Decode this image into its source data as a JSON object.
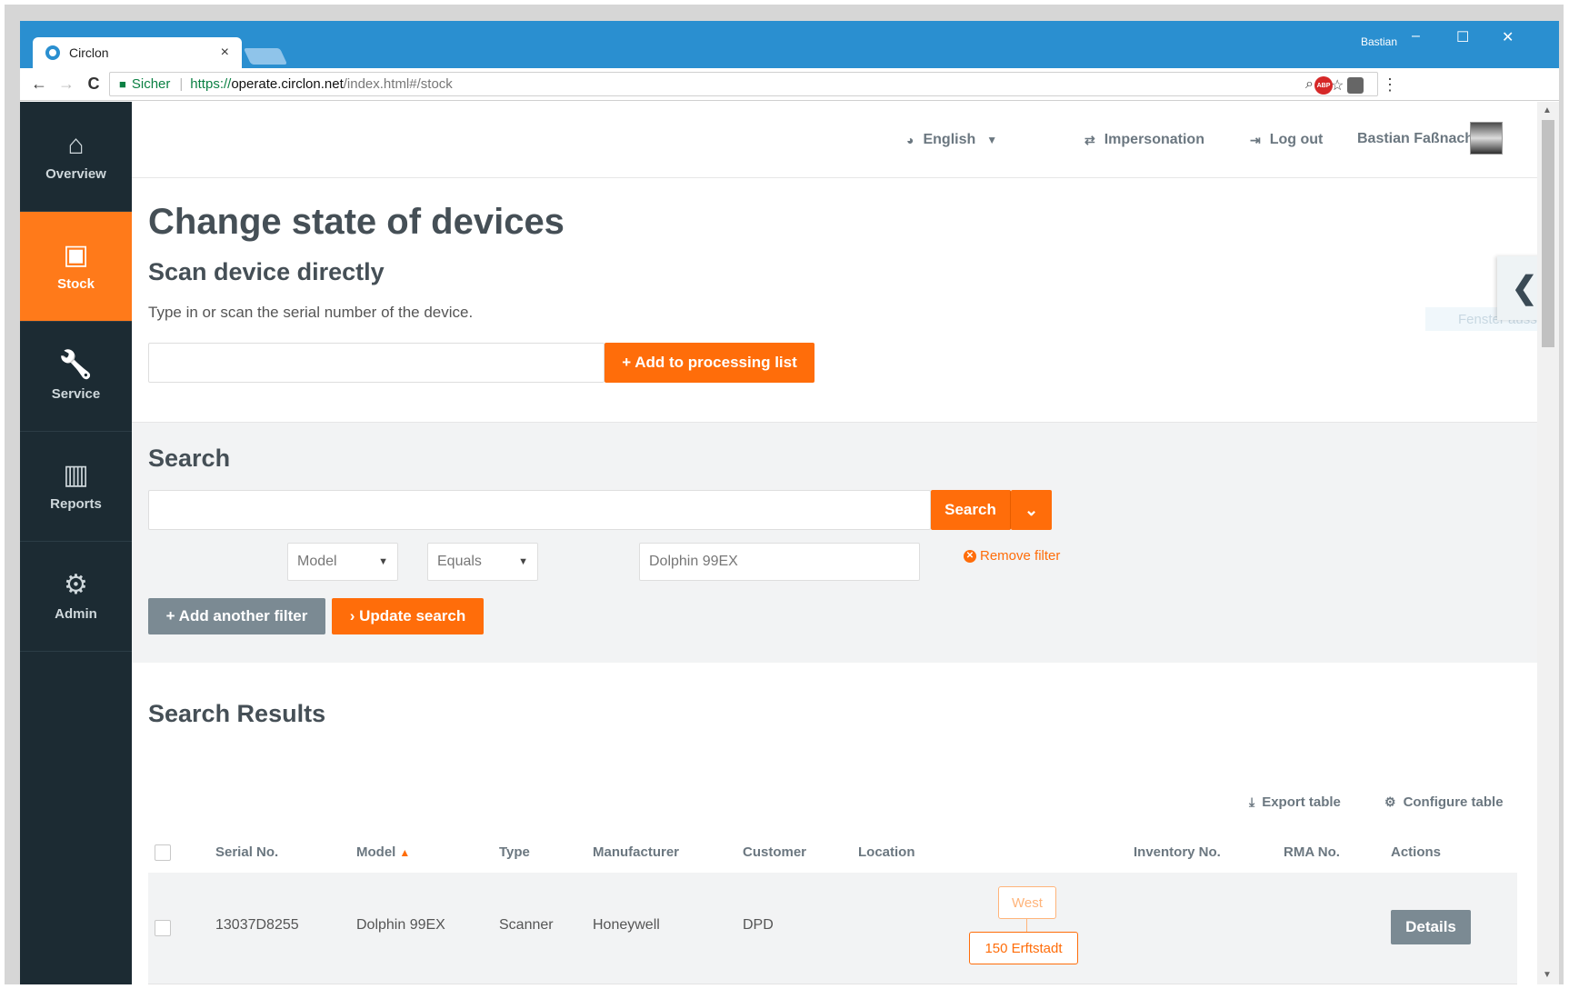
{
  "browser": {
    "tab_title": "Circlon",
    "tab_close": "×",
    "window_user": "Bastian",
    "window_controls": {
      "minimize": "–",
      "maximize": "☐",
      "close": "✕"
    },
    "nav": {
      "back": "←",
      "forward": "→",
      "reload": "C"
    },
    "secure_label": "Sicher",
    "url_scheme": "https://",
    "url_host": "operate.circlon.net",
    "url_path": "/index.html#/stock",
    "extension_badge": "ABP"
  },
  "sidebar": {
    "items": [
      {
        "label": "Overview",
        "icon": "home-icon",
        "glyph": "⌂"
      },
      {
        "label": "Stock",
        "icon": "clipboard-icon",
        "glyph": "▣"
      },
      {
        "label": "Service",
        "icon": "wrench-icon",
        "glyph": "🔧"
      },
      {
        "label": "Reports",
        "icon": "bar-chart-icon",
        "glyph": "▥"
      },
      {
        "label": "Admin",
        "icon": "gear-icon",
        "glyph": "⚙"
      }
    ],
    "active": "Stock"
  },
  "header": {
    "language": "English",
    "impersonation": "Impersonation",
    "logout": "Log out",
    "user_name": "Bastian Faßnacht"
  },
  "scan": {
    "page_title": "Change state of devices",
    "section_title": "Scan device directly",
    "hint": "Type in or scan the serial number of the device.",
    "input_value": "",
    "add_button": "+ Add to processing list"
  },
  "side_panel": {
    "toggle_glyph": "❮",
    "hint_text": "Fenster ausschneiden"
  },
  "search": {
    "title": "Search",
    "input_value": "",
    "button_label": "Search",
    "dropdown_glyph": "⌄",
    "filter": {
      "field": "Model",
      "operator": "Equals",
      "value": "Dolphin 99EX"
    },
    "remove_filter": "Remove filter",
    "add_filter": "+ Add another filter",
    "update_search": "› Update search"
  },
  "results": {
    "title": "Search Results",
    "export_table": "Export table",
    "configure_table": "Configure table",
    "columns": [
      "Serial No.",
      "Model",
      "Type",
      "Manufacturer",
      "Customer",
      "Location",
      "Inventory No.",
      "RMA No.",
      "Actions"
    ],
    "sort_column": "Model",
    "rows": [
      {
        "serial": "13037D8255",
        "model": "Dolphin 99EX",
        "type": "Scanner",
        "manufacturer": "Honeywell",
        "customer": "DPD",
        "location_parent": "West",
        "location": "150 Erftstadt",
        "inventory": "",
        "rma": "",
        "action": "Details"
      }
    ]
  },
  "colors": {
    "accent": "#ff6d0a",
    "sidebar_bg": "#1c2b33",
    "titlebar": "#2a8fd0",
    "secondary_button": "#7b8a93"
  }
}
